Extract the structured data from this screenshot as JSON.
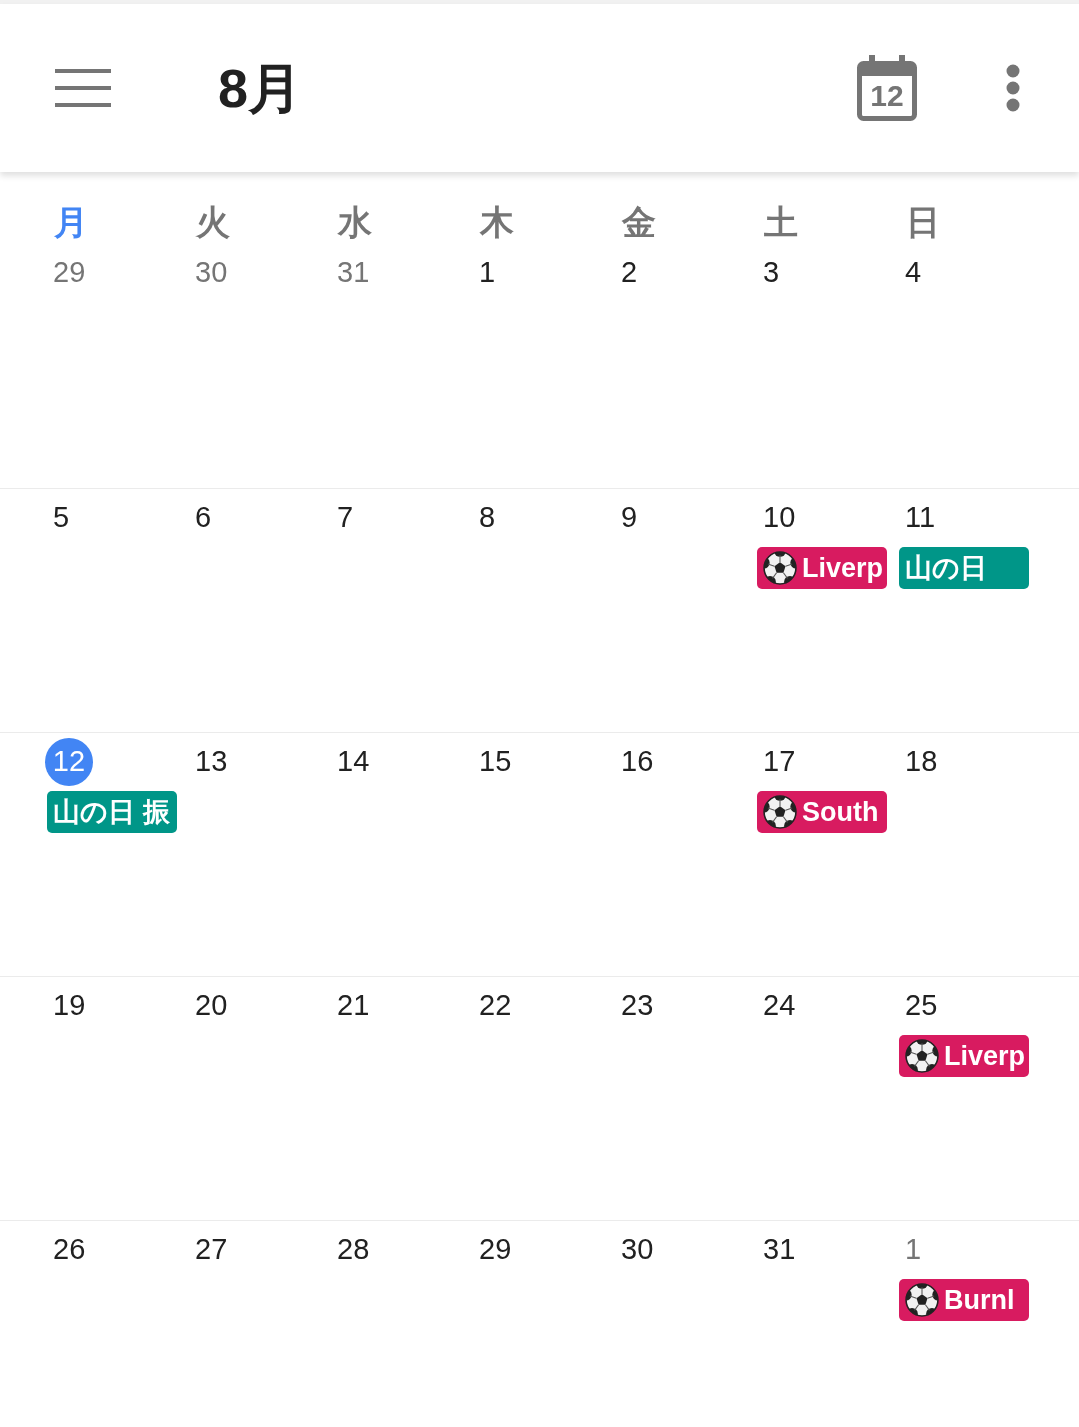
{
  "top_bar": {
    "title": "8月",
    "today_button": {
      "label": "12"
    }
  },
  "weekdays": [
    {
      "label": "月",
      "current": true
    },
    {
      "label": "火",
      "current": false
    },
    {
      "label": "水",
      "current": false
    },
    {
      "label": "木",
      "current": false
    },
    {
      "label": "金",
      "current": false
    },
    {
      "label": "土",
      "current": false
    },
    {
      "label": "日",
      "current": false
    }
  ],
  "weeks": [
    {
      "days": [
        {
          "date": "29",
          "in_month": false,
          "today": false
        },
        {
          "date": "30",
          "in_month": false,
          "today": false
        },
        {
          "date": "31",
          "in_month": false,
          "today": false
        },
        {
          "date": "1",
          "in_month": true,
          "today": false
        },
        {
          "date": "2",
          "in_month": true,
          "today": false
        },
        {
          "date": "3",
          "in_month": true,
          "today": false
        },
        {
          "date": "4",
          "in_month": true,
          "today": false
        }
      ]
    },
    {
      "days": [
        {
          "date": "5",
          "in_month": true,
          "today": false
        },
        {
          "date": "6",
          "in_month": true,
          "today": false
        },
        {
          "date": "7",
          "in_month": true,
          "today": false
        },
        {
          "date": "8",
          "in_month": true,
          "today": false
        },
        {
          "date": "9",
          "in_month": true,
          "today": false
        },
        {
          "date": "10",
          "in_month": true,
          "today": false,
          "events": [
            {
              "kind": "match",
              "title": "Liverp",
              "color": "#d81b60"
            }
          ]
        },
        {
          "date": "11",
          "in_month": true,
          "today": false,
          "events": [
            {
              "kind": "holiday",
              "title": "山の日",
              "color": "#009688"
            }
          ]
        }
      ]
    },
    {
      "days": [
        {
          "date": "12",
          "in_month": true,
          "today": true,
          "events": [
            {
              "kind": "holiday",
              "title": "山の日 振",
              "color": "#009688"
            }
          ]
        },
        {
          "date": "13",
          "in_month": true,
          "today": false
        },
        {
          "date": "14",
          "in_month": true,
          "today": false
        },
        {
          "date": "15",
          "in_month": true,
          "today": false
        },
        {
          "date": "16",
          "in_month": true,
          "today": false
        },
        {
          "date": "17",
          "in_month": true,
          "today": false,
          "events": [
            {
              "kind": "match",
              "title": "South",
              "color": "#d81b60"
            }
          ]
        },
        {
          "date": "18",
          "in_month": true,
          "today": false
        }
      ]
    },
    {
      "days": [
        {
          "date": "19",
          "in_month": true,
          "today": false
        },
        {
          "date": "20",
          "in_month": true,
          "today": false
        },
        {
          "date": "21",
          "in_month": true,
          "today": false
        },
        {
          "date": "22",
          "in_month": true,
          "today": false
        },
        {
          "date": "23",
          "in_month": true,
          "today": false
        },
        {
          "date": "24",
          "in_month": true,
          "today": false
        },
        {
          "date": "25",
          "in_month": true,
          "today": false,
          "events": [
            {
              "kind": "match",
              "title": "Liverp",
              "color": "#d81b60"
            }
          ]
        }
      ]
    },
    {
      "days": [
        {
          "date": "26",
          "in_month": true,
          "today": false
        },
        {
          "date": "27",
          "in_month": true,
          "today": false
        },
        {
          "date": "28",
          "in_month": true,
          "today": false
        },
        {
          "date": "29",
          "in_month": true,
          "today": false
        },
        {
          "date": "30",
          "in_month": true,
          "today": false
        },
        {
          "date": "31",
          "in_month": true,
          "today": false
        },
        {
          "date": "1",
          "in_month": false,
          "today": false,
          "events": [
            {
              "kind": "match",
              "title": "Burnl",
              "color": "#d81b60"
            }
          ]
        }
      ]
    }
  ]
}
